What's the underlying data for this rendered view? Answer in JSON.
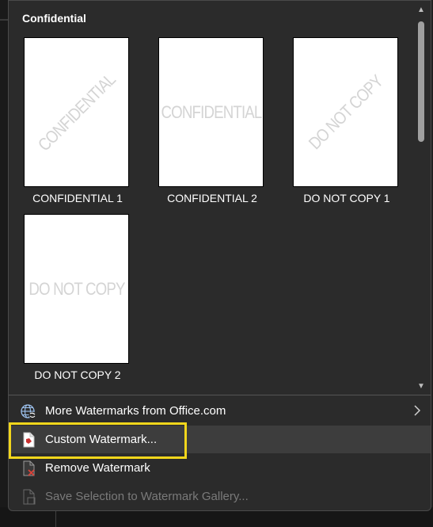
{
  "gallery": {
    "section_title": "Confidential",
    "tiles": [
      {
        "label": "CONFIDENTIAL 1",
        "watermark": "CONFIDENTIAL",
        "orientation": "diagonal"
      },
      {
        "label": "CONFIDENTIAL 2",
        "watermark": "CONFIDENTIAL",
        "orientation": "horizontal"
      },
      {
        "label": "DO NOT COPY 1",
        "watermark": "DO NOT COPY",
        "orientation": "diagonal"
      },
      {
        "label": "DO NOT COPY 2",
        "watermark": "DO NOT COPY",
        "orientation": "horizontal"
      }
    ]
  },
  "menu": {
    "more_watermarks": {
      "label": "More Watermarks from Office.com",
      "icon": "globe-icon",
      "has_submenu": true
    },
    "custom_watermark": {
      "label": "Custom Watermark...",
      "icon": "custom-watermark-icon",
      "highlighted": true
    },
    "remove_watermark": {
      "label": "Remove Watermark",
      "icon": "remove-watermark-icon"
    },
    "save_selection": {
      "label": "Save Selection to Watermark Gallery...",
      "icon": "save-gallery-icon",
      "disabled": true
    }
  },
  "colors": {
    "panel_bg": "#2b2b2b",
    "hover_bg": "#3d3d3d",
    "highlight": "#f2d61c",
    "disabled_text": "#7a7a7a",
    "watermark_text": "#d4d4d4"
  }
}
